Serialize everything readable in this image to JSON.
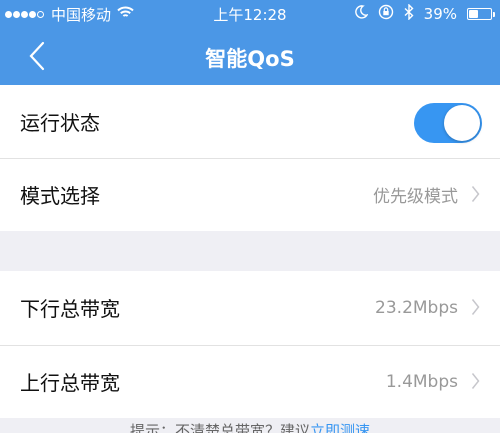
{
  "status_bar": {
    "carrier": "中国移动",
    "time": "上午12:28",
    "battery": "39%",
    "battery_level": 0.39,
    "icons": [
      "signal-dots-icon",
      "wifi-icon",
      "do-not-disturb-icon",
      "rotation-lock-icon",
      "bluetooth-icon",
      "battery-icon"
    ]
  },
  "nav": {
    "title": "智能QoS",
    "back_icon": "back-chevron-icon"
  },
  "settings": {
    "run_status": {
      "label": "运行状态",
      "enabled": true
    },
    "mode": {
      "label": "模式选择",
      "value": "优先级模式"
    },
    "downlink": {
      "label": "下行总带宽",
      "value": "23.2Mbps"
    },
    "uplink": {
      "label": "上行总带宽",
      "value": "1.4Mbps"
    }
  },
  "hint": {
    "text": "提示：不清楚总带宽？建议",
    "link": "立即测速"
  },
  "colors": {
    "header": "#4b97e6",
    "toggle_on": "#3796f2",
    "background": "#efeff4"
  }
}
